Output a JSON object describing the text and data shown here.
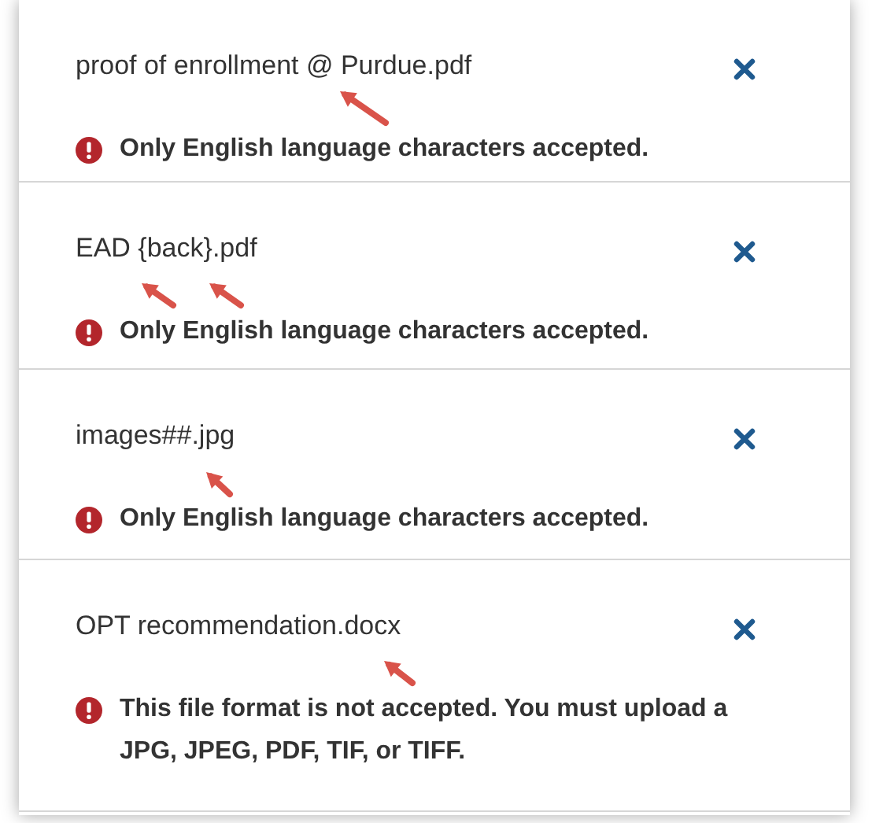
{
  "files": [
    {
      "name": "proof of enrollment @ Purdue.pdf",
      "error": "Only English language characters accepted."
    },
    {
      "name": "EAD {back}.pdf",
      "error": "Only English language characters accepted."
    },
    {
      "name": "images##.jpg",
      "error": "Only English language characters accepted."
    },
    {
      "name": "OPT recommendation.docx",
      "error": "This file format is not accepted. You must upload a JPG, JPEG, PDF, TIF, or TIFF."
    }
  ]
}
